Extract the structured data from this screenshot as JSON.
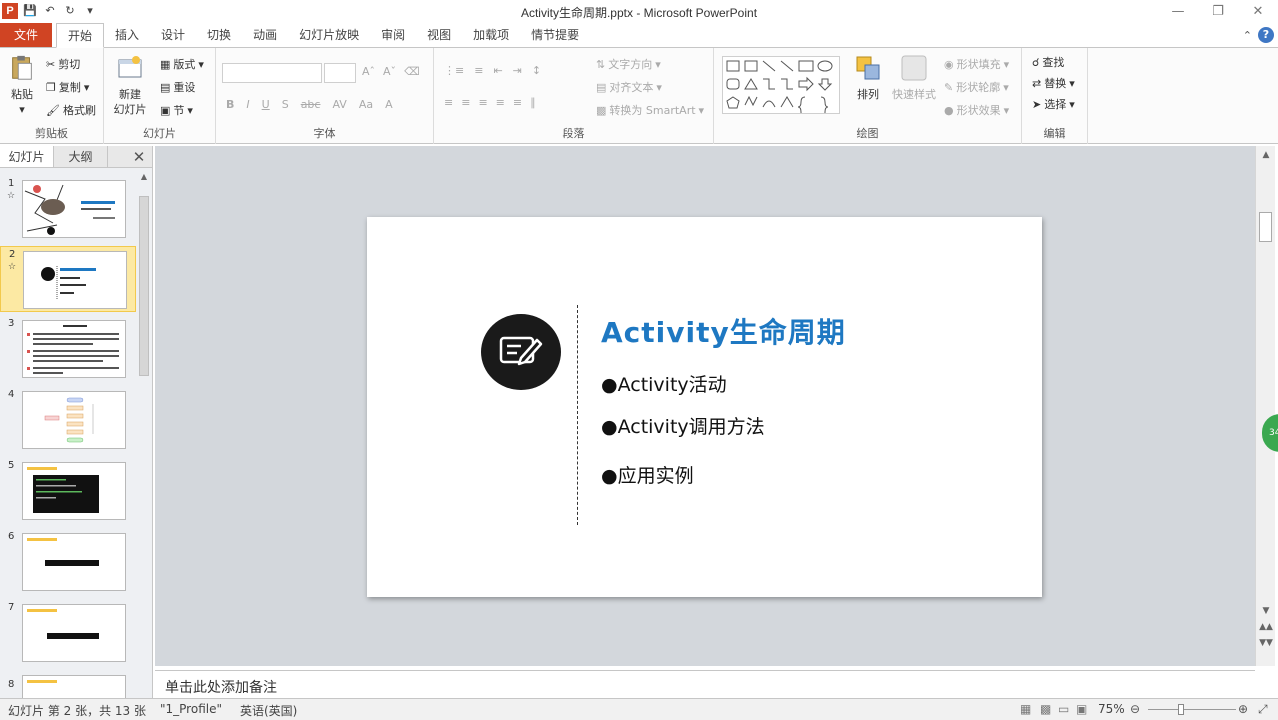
{
  "window": {
    "title": "Activity生命周期.pptx - Microsoft PowerPoint",
    "app_icon": "P"
  },
  "ribbon_tabs": [
    "文件",
    "开始",
    "插入",
    "设计",
    "切换",
    "动画",
    "幻灯片放映",
    "审阅",
    "视图",
    "加载项",
    "情节提要"
  ],
  "clipboard": {
    "paste": "粘贴",
    "cut": "剪切",
    "copy": "复制",
    "format_painter": "格式刷",
    "label": "剪贴板"
  },
  "slides_group": {
    "new_slide_1": "新建",
    "new_slide_2": "幻灯片",
    "layout": "版式",
    "reset": "重设",
    "section": "节",
    "label": "幻灯片"
  },
  "font_group": {
    "font_name": "",
    "font_size": "",
    "label": "字体"
  },
  "paragraph_group": {
    "text_direction": "文字方向",
    "align_text": "对齐文本",
    "convert_smartart": "转换为 SmartArt",
    "label": "段落"
  },
  "drawing_group": {
    "arrange": "排列",
    "quick_styles": "快速样式",
    "shape_fill": "形状填充",
    "shape_outline": "形状轮廓",
    "shape_effects": "形状效果",
    "label": "绘图"
  },
  "editing_group": {
    "find": "查找",
    "replace": "替换",
    "select": "选择",
    "label": "编辑"
  },
  "left_panel": {
    "tab_slides": "幻灯片",
    "tab_outline": "大纲",
    "thumb_numbers": [
      "1",
      "2",
      "3",
      "4",
      "5",
      "6",
      "7",
      "8"
    ],
    "selected": "2"
  },
  "slide": {
    "title": "Activity生命周期",
    "bullets": [
      "●Activity活动",
      "●Activity调用方法",
      "●应用实例"
    ]
  },
  "notes_placeholder": "单击此处添加备注",
  "status_bar": {
    "slide_info": "幻灯片 第 2 张，共 13 张",
    "theme": "\"1_Profile\"",
    "language": "英语(英国)",
    "zoom": "75%"
  },
  "side_badge": "34",
  "colors": {
    "file_tab": "#d04423",
    "title_blue": "#1e78c2",
    "selection_yellow": "#fce9a3"
  }
}
